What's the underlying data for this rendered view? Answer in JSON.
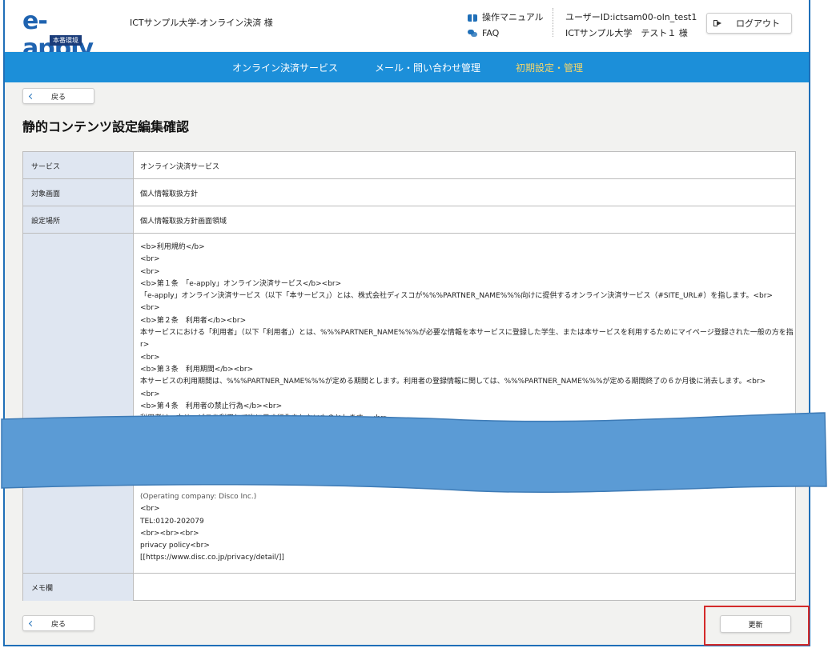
{
  "header": {
    "logo_text": "e-apply",
    "logo_badge": "本番環境",
    "org_name": "ICTサンプル大学-オンライン決済 様",
    "manual_label": "操作マニュアル",
    "faq_label": "FAQ",
    "user_id": "ユーザーID:ictsam00-oln_test1",
    "user_name": "ICTサンプル大学　テスト１ 様",
    "logout_label": "ログアウト"
  },
  "nav": {
    "items": [
      {
        "label": "オンライン決済サービス"
      },
      {
        "label": "メール・問い合わせ管理"
      },
      {
        "label": "初期設定・管理"
      }
    ]
  },
  "back_label": "戻る",
  "page_title": "静的コンテンツ設定編集確認",
  "rows": [
    {
      "label": "サービス",
      "value": "オンライン決済サービス"
    },
    {
      "label": "対象画面",
      "value": "個人情報取扱方針"
    },
    {
      "label": "設定場所",
      "value": "個人情報取扱方針画面領域"
    }
  ],
  "content_lines": [
    "<b>利用規約</b>",
    "<br>",
    "<br>",
    "<b>第１条　「e-apply」オンライン決済サービス</b><br>",
    "「e-apply」オンライン決済サービス（以下「本サービス」）とは、株式会社ディスコが%%%PARTNER_NAME%%%向けに提供するオンライン決済サービス（#SITE_URL#）を指します。<br>",
    "<br>",
    "<b>第２条　利用者</b><br>",
    "本サービスにおける「利用者」（以下「利用者」）とは、%%%PARTNER_NAME%%%が必要な情報を本サービスに登録した学生、または本サービスを利用するためにマイページ登録された一般の方を指します。<b",
    "r>",
    "<br>",
    "<b>第３条　利用期間</b><br>",
    "本サービスの利用期間は、%%%PARTNER_NAME%%%が定める期間とします。利用者の登録情報に関しては、%%%PARTNER_NAME%%%が定める期間終了の６か月後に消去します。<br>",
    "<br>",
    "<b>第４条　利用者の禁止行為</b><br>",
    "利用者は、本サービスを利用して次に示す行為をしないものとします。<br>"
  ],
  "content_tail_lines": [
    "(Operating company: Disco Inc.)",
    "<br>",
    "TEL:0120-202079",
    "<br><br><br>",
    "privacy policy<br>",
    "[[https://www.disc.co.jp/privacy/detail/]]"
  ],
  "memo_label": "メモ欄",
  "update_label": "更新",
  "colors": {
    "nav_bg": "#1c8fd9",
    "nav_active": "#f5d66a",
    "label_bg": "#dfe6f1",
    "banner": "#5b9bd5",
    "highlight": "#d42a2a"
  }
}
